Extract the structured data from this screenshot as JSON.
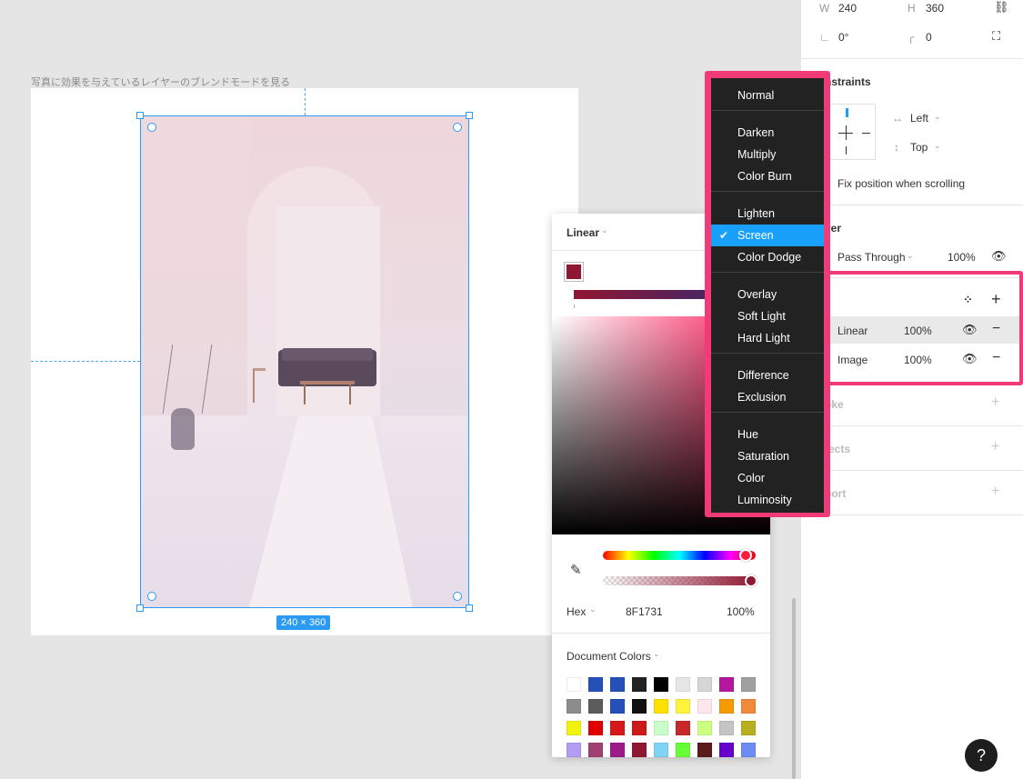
{
  "canvas": {
    "frame_label": "写真に効果を与えているレイヤーのブレンドモードを見る",
    "size_badge": "240 × 360"
  },
  "color_picker": {
    "type_label": "Linear",
    "hex_mode": "Hex",
    "hex_value": "8F1731",
    "alpha": "100%",
    "document_colors_label": "Document Colors",
    "swatches": [
      "#ffffff",
      "#2450b8",
      "#2450b8",
      "#222222",
      "#000000",
      "#e6e6e6",
      "#d6d6d6",
      "#b5179e",
      "#a0a0a0",
      "#8c8c8c",
      "#5c5c5c",
      "#2450b8",
      "#111111",
      "#ffe000",
      "#fff23b",
      "#fde7ec",
      "#f59a00",
      "#f08a3a",
      "#f2f20a",
      "#e00000",
      "#d61818",
      "#cc1a1a",
      "#c9ffc9",
      "#c82828",
      "#ccff80",
      "#c4c4c4",
      "#b8b020",
      "#b39cf5",
      "#a23e72",
      "#9c1a8a",
      "#8f1731",
      "#7fd4f5",
      "#66ff33",
      "#5c1a1a",
      "#6600cc",
      "#6c8cf5"
    ]
  },
  "blend_menu": {
    "groups": [
      [
        "Normal"
      ],
      [
        "Darken",
        "Multiply",
        "Color Burn"
      ],
      [
        "Lighten",
        "Screen",
        "Color Dodge"
      ],
      [
        "Overlay",
        "Soft Light",
        "Hard Light"
      ],
      [
        "Difference",
        "Exclusion"
      ],
      [
        "Hue",
        "Saturation",
        "Color",
        "Luminosity"
      ]
    ],
    "selected": "Screen"
  },
  "panel": {
    "w_label": "W",
    "w_value": "240",
    "h_label": "H",
    "h_value": "360",
    "rotation": "0°",
    "radius": "0",
    "constraints_title": "nstraints",
    "constraint_h": "Left",
    "constraint_v": "Top",
    "fix_position": "Fix position when scrolling",
    "layer_title": "yer",
    "layer_blend": "Pass Through",
    "layer_opacity": "100%",
    "fills": [
      {
        "type": "Linear",
        "opacity": "100%"
      },
      {
        "type": "Image",
        "opacity": "100%"
      }
    ],
    "stroke_title": "oke",
    "effects_title": "fects",
    "export_title": "port"
  },
  "help_label": "?"
}
